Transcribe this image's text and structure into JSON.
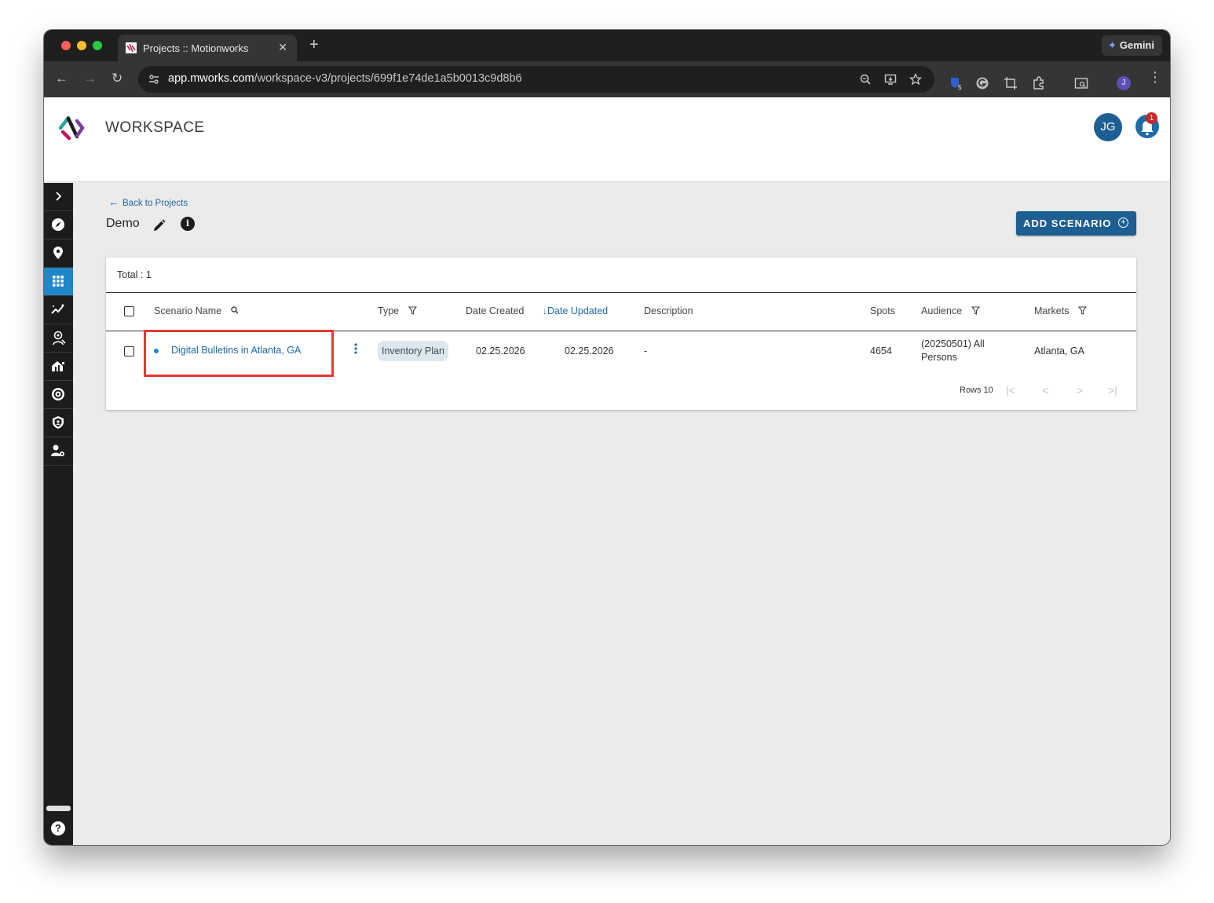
{
  "browser": {
    "tab_title": "Projects :: Motionworks",
    "url_host": "app.mworks.com",
    "url_path": "/workspace-v3/projects/699f1e74de1a5b0013c9d8b6",
    "gemini_label": "Gemini",
    "extension_badge": "5",
    "profile_initial": "J"
  },
  "app": {
    "title": "WORKSPACE",
    "user_initials": "JG",
    "notification_count": "1",
    "colors": {
      "primary": "#1d5e93",
      "accent": "#1f86c7",
      "sidebar": "#1c1c1c"
    }
  },
  "sidebar": {
    "items": [
      "expand-icon",
      "compass-icon",
      "location-pin-icon",
      "grid-icon",
      "trend-icon",
      "audience-icon",
      "home-chart-icon",
      "target-icon",
      "shield-icon",
      "user-settings-icon"
    ],
    "active_index": 3,
    "help_label": "?"
  },
  "page": {
    "back_label": "Back to Projects",
    "project_name": "Demo",
    "info_label": "i",
    "add_button_label": "ADD SCENARIO"
  },
  "table": {
    "total_label": "Total : 1",
    "columns": {
      "scenario_name": "Scenario Name",
      "type": "Type",
      "date_created": "Date Created",
      "date_updated": "Date Updated",
      "description": "Description",
      "spots": "Spots",
      "audience": "Audience",
      "markets": "Markets"
    },
    "rows": [
      {
        "scenario_name": "Digital Bulletins in Atlanta, GA",
        "type": "Inventory Plan",
        "date_created": "02.25.2026",
        "date_updated": "02.25.2026",
        "description": "-",
        "spots": "4654",
        "audience_line1": "(20250501) All",
        "audience_line2": "Persons",
        "markets": "Atlanta, GA"
      }
    ],
    "rows_label": "Rows 10"
  }
}
